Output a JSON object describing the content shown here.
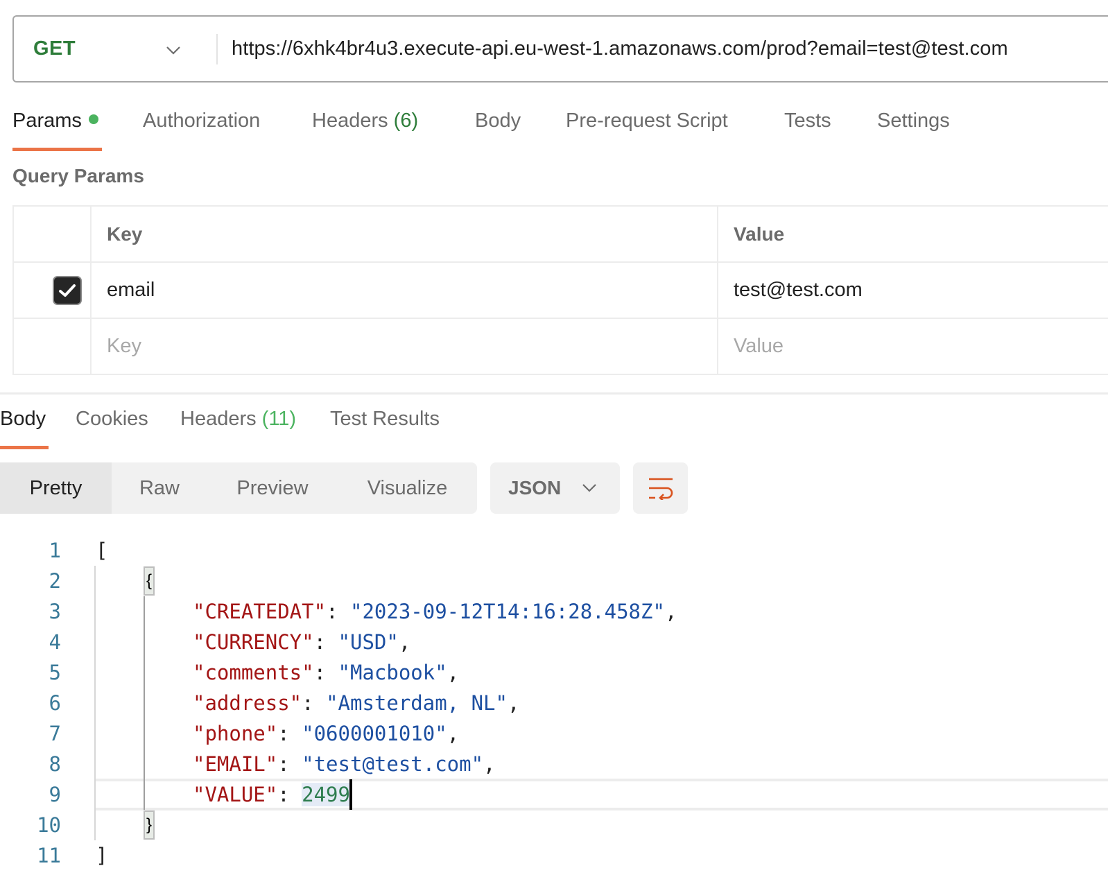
{
  "request": {
    "method": "GET",
    "url": "https://6xhk4br4u3.execute-api.eu-west-1.amazonaws.com/prod?email=test@test.com",
    "tabs": [
      {
        "label": "Params",
        "active": true,
        "has_dot": true
      },
      {
        "label": "Authorization"
      },
      {
        "label": "Headers ",
        "count": "(6)"
      },
      {
        "label": "Body"
      },
      {
        "label": "Pre-request Script"
      },
      {
        "label": "Tests"
      },
      {
        "label": "Settings"
      }
    ]
  },
  "query_params": {
    "title": "Query Params",
    "columns": {
      "key": "Key",
      "value": "Value"
    },
    "rows": [
      {
        "enabled": true,
        "key": "email",
        "value": "test@test.com"
      }
    ],
    "placeholder": {
      "key": "Key",
      "value": "Value"
    }
  },
  "response": {
    "tabs": [
      {
        "label": "Body",
        "active": true
      },
      {
        "label": "Cookies"
      },
      {
        "label": "Headers ",
        "count": "(11)"
      },
      {
        "label": "Test Results"
      }
    ],
    "view_modes": [
      "Pretty",
      "Raw",
      "Preview",
      "Visualize"
    ],
    "active_view": "Pretty",
    "format": "JSON",
    "icons": {
      "format_chevron": "chevron-down-icon",
      "wrap": "wrap-lines-icon"
    },
    "body_lines": {
      "line_numbers": [
        "1",
        "2",
        "3",
        "4",
        "5",
        "6",
        "7",
        "8",
        "9",
        "10",
        "11"
      ],
      "open_bracket": "[",
      "open_brace": "{",
      "fields": [
        {
          "key": "\"CREATEDAT\"",
          "value": "\"2023-09-12T14:16:28.458Z\"",
          "type": "string",
          "trail": ","
        },
        {
          "key": "\"CURRENCY\"",
          "value": "\"USD\"",
          "type": "string",
          "trail": ","
        },
        {
          "key": "\"comments\"",
          "value": "\"Macbook\"",
          "type": "string",
          "trail": ","
        },
        {
          "key": "\"address\"",
          "value": "\"Amsterdam, NL\"",
          "type": "string",
          "trail": ","
        },
        {
          "key": "\"phone\"",
          "value": "\"0600001010\"",
          "type": "string",
          "trail": ","
        },
        {
          "key": "\"EMAIL\"",
          "value": "\"test@test.com\"",
          "type": "string",
          "trail": ","
        },
        {
          "key": "\"VALUE\"",
          "value": "2499",
          "type": "number",
          "trail": ""
        }
      ],
      "close_brace": "}",
      "close_bracket": "]"
    }
  },
  "colors": {
    "accent": "#eb7447",
    "method_get": "#2e7d3a",
    "count_green": "#4bb35f",
    "json_key": "#a31515",
    "json_string": "#1d4fa1",
    "json_number": "#2e7d4f",
    "line_number": "#3a7a99"
  }
}
